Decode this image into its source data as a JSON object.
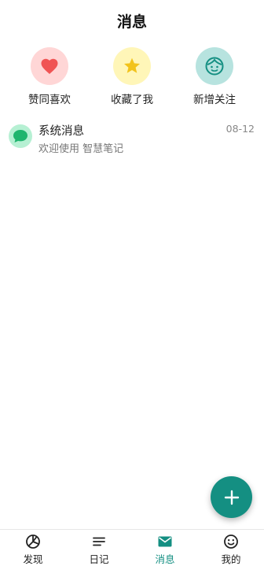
{
  "header": {
    "title": "消息"
  },
  "quick_actions": [
    {
      "label": "赞同喜欢",
      "icon": "heart-icon",
      "bg": "#ffd6d6",
      "color": "#f05454"
    },
    {
      "label": "收藏了我",
      "icon": "star-icon",
      "bg": "#fff6b8",
      "color": "#f2c31b"
    },
    {
      "label": "新增关注",
      "icon": "face-icon",
      "bg": "#b7e3df",
      "color": "#148f82"
    }
  ],
  "messages": [
    {
      "title": "系统消息",
      "subtitle": "欢迎使用 智慧笔记",
      "time": "08-12",
      "icon": "chat-bubble-icon"
    }
  ],
  "fab": {
    "icon": "plus-icon"
  },
  "tabbar": {
    "active": 2,
    "accent": "#148f82",
    "items": [
      {
        "label": "发现",
        "icon": "discover-icon"
      },
      {
        "label": "日记",
        "icon": "lines-icon"
      },
      {
        "label": "消息",
        "icon": "mail-icon"
      },
      {
        "label": "我的",
        "icon": "smiley-icon"
      }
    ]
  }
}
